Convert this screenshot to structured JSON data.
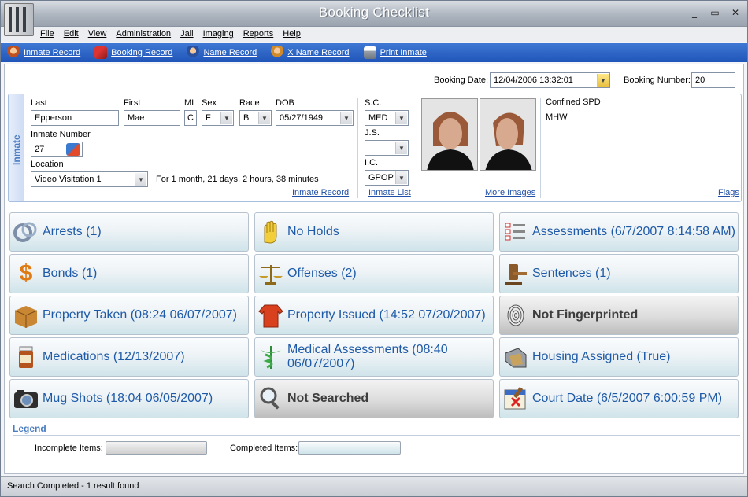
{
  "window": {
    "title": "Booking Checklist",
    "controls": [
      "_",
      "▭",
      "✕"
    ]
  },
  "menu": [
    "File",
    "Edit",
    "View",
    "Administration",
    "Jail",
    "Imaging",
    "Reports",
    "Help"
  ],
  "toolbar": {
    "inmate_record": "Inmate Record",
    "booking_record": "Booking Record",
    "name_record": "Name Record",
    "x_name_record": "X Name Record",
    "print_inmate": "Print Inmate"
  },
  "booking": {
    "date_label": "Booking Date:",
    "date_value": "12/04/2006 13:32:01",
    "number_label": "Booking Number:",
    "number_value": "20"
  },
  "inmate": {
    "tab_label": "Inmate",
    "last_label": "Last",
    "last_value": "Epperson",
    "first_label": "First",
    "first_value": "Mae",
    "mi_label": "MI",
    "mi_value": "C",
    "sex_label": "Sex",
    "sex_value": "F",
    "race_label": "Race",
    "race_value": "B",
    "dob_label": "DOB",
    "dob_value": "05/27/1949",
    "number_label": "Inmate Number",
    "number_value": "27",
    "location_label": "Location",
    "location_value": "Video Visitation 1",
    "duration": "For 1 month, 21 days, 2 hours, 38 minutes",
    "record_link": "Inmate Record",
    "sc_label": "S.C.",
    "sc_value": "MED",
    "js_label": "J.S.",
    "js_value": "",
    "ic_label": "I.C.",
    "ic_value": "GPOP",
    "list_link": "Inmate List",
    "more_images": "More Images",
    "confined": "Confined SPD",
    "flag_code": "MHW",
    "flags_link": "Flags"
  },
  "tiles": [
    {
      "text": "Arrests (1)",
      "icon": "handcuffs-icon",
      "state": "incomplete"
    },
    {
      "text": "No Holds",
      "icon": "hand-icon",
      "state": "incomplete"
    },
    {
      "text": "Assessments (6/7/2007 8:14:58 AM)",
      "icon": "checklist-icon",
      "state": "incomplete"
    },
    {
      "text": "Bonds (1)",
      "icon": "dollar-icon",
      "state": "incomplete"
    },
    {
      "text": "Offenses (2)",
      "icon": "scales-icon",
      "state": "incomplete"
    },
    {
      "text": "Sentences (1)",
      "icon": "gavel-icon",
      "state": "incomplete"
    },
    {
      "text": "Property Taken (08:24 06/07/2007)",
      "icon": "box-icon",
      "state": "incomplete"
    },
    {
      "text": "Property Issued (14:52 07/20/2007)",
      "icon": "jumpsuit-icon",
      "state": "incomplete"
    },
    {
      "text": "Not Fingerprinted",
      "icon": "fingerprint-icon",
      "state": "complete"
    },
    {
      "text": "Medications (12/13/2007)",
      "icon": "pill-bottle-icon",
      "state": "incomplete"
    },
    {
      "text": "Medical Assessments (08:40 06/07/2007)",
      "icon": "caduceus-icon",
      "state": "incomplete"
    },
    {
      "text": "Housing Assigned (True)",
      "icon": "housing-icon",
      "state": "incomplete"
    },
    {
      "text": "Mug Shots (18:04 06/05/2007)",
      "icon": "camera-icon",
      "state": "incomplete"
    },
    {
      "text": "Not Searched",
      "icon": "magnifier-icon",
      "state": "complete"
    },
    {
      "text": "Court Date (6/5/2007 6:00:59 PM)",
      "icon": "calendar-icon",
      "state": "incomplete"
    }
  ],
  "legend": {
    "title": "Legend",
    "incomplete_label": "Incomplete Items:",
    "completed_label": "Completed Items:"
  },
  "status": "Search Completed - 1 result found"
}
